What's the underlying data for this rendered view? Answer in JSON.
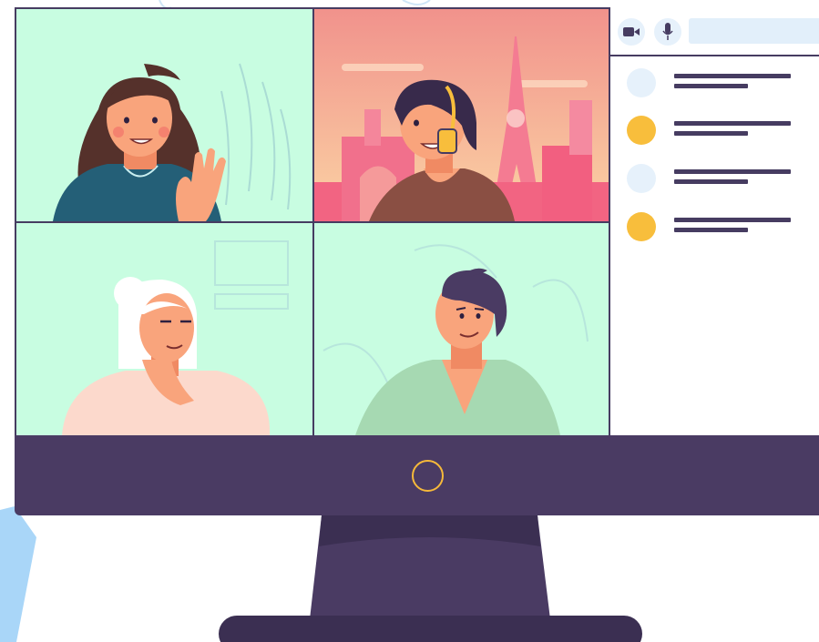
{
  "colors": {
    "accent": "#f8be3c",
    "frame": "#463c61",
    "bezel": "#4a3b63",
    "mint_tile": "#c8fde1",
    "search_bg": "#e2effa",
    "pink_sky": "#f6a09d",
    "avatar_light": "#e6f1fb"
  },
  "toolbar": {
    "camera_icon": "video-camera-icon",
    "mic_icon": "microphone-icon",
    "search_value": ""
  },
  "participants": [
    {
      "avatar": "light"
    },
    {
      "avatar": "accent"
    },
    {
      "avatar": "light"
    },
    {
      "avatar": "accent"
    }
  ],
  "tiles": [
    {
      "participant": "woman-waving",
      "background": "mint"
    },
    {
      "participant": "woman-with-headphones",
      "background": "paris"
    },
    {
      "participant": "woman-white-hair",
      "background": "mint"
    },
    {
      "participant": "man",
      "background": "mint"
    }
  ]
}
